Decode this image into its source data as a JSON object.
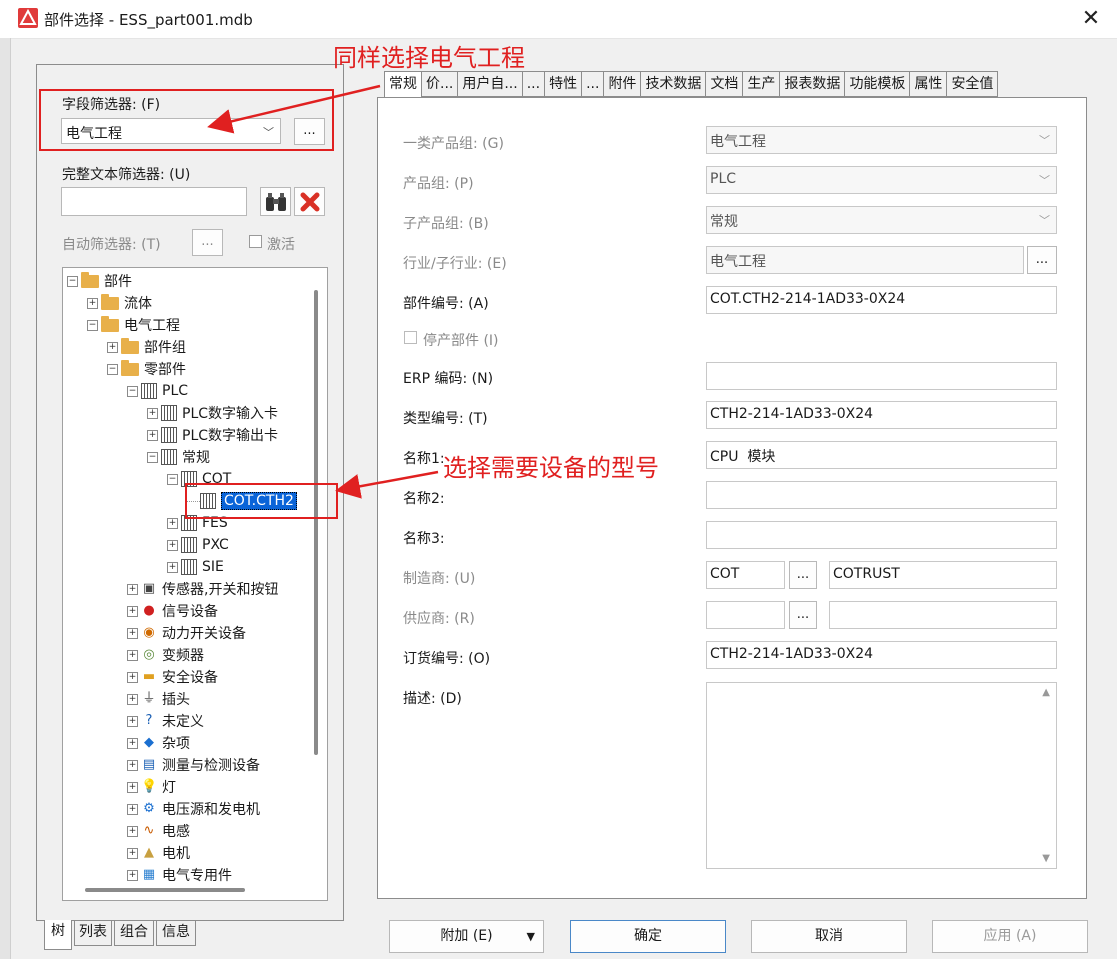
{
  "window": {
    "title": "部件选择 - ESS_part001.mdb",
    "close_glyph": "✕"
  },
  "left": {
    "field_filter_label": "字段筛选器: (F)",
    "field_filter_value": "电气工程",
    "more_button": "...",
    "fulltext_label": "完整文本筛选器: (U)",
    "fulltext_value": "",
    "auto_filter_label": "自动筛选器: (T)",
    "auto_more_button": "...",
    "activate_label": "激活",
    "tree": [
      {
        "label": "部件",
        "level": 0,
        "expander": "−",
        "icon": "folder"
      },
      {
        "label": "流体",
        "level": 1,
        "expander": "+",
        "icon": "folder"
      },
      {
        "label": "电气工程",
        "level": 1,
        "expander": "−",
        "icon": "folder"
      },
      {
        "label": "部件组",
        "level": 2,
        "expander": "+",
        "icon": "folder"
      },
      {
        "label": "零部件",
        "level": 2,
        "expander": "−",
        "icon": "folder"
      },
      {
        "label": "PLC",
        "level": 3,
        "expander": "−",
        "icon": "plc"
      },
      {
        "label": "PLC数字输入卡",
        "level": 4,
        "expander": "+",
        "icon": "plc"
      },
      {
        "label": "PLC数字输出卡",
        "level": 4,
        "expander": "+",
        "icon": "plc"
      },
      {
        "label": "常规",
        "level": 4,
        "expander": "−",
        "icon": "plc"
      },
      {
        "label": "COT",
        "level": 5,
        "expander": "−",
        "icon": "plc"
      },
      {
        "label": "COT.CTH2",
        "level": 6,
        "expander": "",
        "icon": "plc",
        "selected": true
      },
      {
        "label": "FES",
        "level": 5,
        "expander": "+",
        "icon": "plc"
      },
      {
        "label": "PXC",
        "level": 5,
        "expander": "+",
        "icon": "plc"
      },
      {
        "label": "SIE",
        "level": 5,
        "expander": "+",
        "icon": "plc"
      },
      {
        "label": "传感器,开关和按钮",
        "level": 3,
        "expander": "+",
        "icon": "sensor"
      },
      {
        "label": "信号设备",
        "level": 3,
        "expander": "+",
        "icon": "signal"
      },
      {
        "label": "动力开关设备",
        "level": 3,
        "expander": "+",
        "icon": "power"
      },
      {
        "label": "变频器",
        "level": 3,
        "expander": "+",
        "icon": "vfd"
      },
      {
        "label": "安全设备",
        "level": 3,
        "expander": "+",
        "icon": "safety"
      },
      {
        "label": "插头",
        "level": 3,
        "expander": "+",
        "icon": "plug"
      },
      {
        "label": "未定义",
        "level": 3,
        "expander": "+",
        "icon": "question"
      },
      {
        "label": "杂项",
        "level": 3,
        "expander": "+",
        "icon": "misc"
      },
      {
        "label": "测量与检测设备",
        "level": 3,
        "expander": "+",
        "icon": "measure"
      },
      {
        "label": "灯",
        "level": 3,
        "expander": "+",
        "icon": "lamp"
      },
      {
        "label": "电压源和发电机",
        "level": 3,
        "expander": "+",
        "icon": "generator"
      },
      {
        "label": "电感",
        "level": 3,
        "expander": "+",
        "icon": "inductor"
      },
      {
        "label": "电机",
        "level": 3,
        "expander": "+",
        "icon": "motor"
      },
      {
        "label": "电气专用件",
        "level": 3,
        "expander": "+",
        "icon": "special"
      }
    ],
    "bottom_tabs": [
      "树",
      "列表",
      "组合",
      "信息"
    ]
  },
  "tabs": [
    "常规",
    "价...",
    "用户自...",
    "...",
    "特性",
    "...",
    "附件",
    "技术数据",
    "文档",
    "生产",
    "报表数据",
    "功能模板",
    "属性",
    "安全值"
  ],
  "form": {
    "product_group1_label": "一类产品组: (G)",
    "product_group1_value": "电气工程",
    "product_group_label": "产品组: (P)",
    "product_group_value": "PLC",
    "sub_group_label": "子产品组: (B)",
    "sub_group_value": "常规",
    "industry_label": "行业/子行业: (E)",
    "industry_value": "电气工程",
    "part_number_label": "部件编号: (A)",
    "part_number_value": "COT.CTH2-214-1AD33-0X24",
    "discontinued_label": "停产部件 (I)",
    "erp_label": "ERP 编码: (N)",
    "erp_value": "",
    "type_number_label": "类型编号: (T)",
    "type_number_value": "CTH2-214-1AD33-0X24",
    "name1_label": "名称1:",
    "name1_value": "CPU  模块",
    "name2_label": "名称2:",
    "name2_value": "",
    "name3_label": "名称3:",
    "name3_value": "",
    "manufacturer_label": "制造商: (U)",
    "manufacturer_code": "COT",
    "manufacturer_name": "COTRUST",
    "supplier_label": "供应商: (R)",
    "supplier_code": "",
    "supplier_name": "",
    "order_number_label": "订货编号: (O)",
    "order_number_value": "CTH2-214-1AD33-0X24",
    "description_label": "描述: (D)",
    "description_value": "",
    "ellipsis": "..."
  },
  "footer": {
    "attach": "附加 (E)",
    "ok": "确定",
    "cancel": "取消",
    "apply": "应用 (A)"
  },
  "annotations": {
    "top": "同样选择电气工程",
    "middle": "选择需要设备的型号"
  },
  "colors": {
    "annotation": "#e02020",
    "selection": "#0a64d8"
  }
}
